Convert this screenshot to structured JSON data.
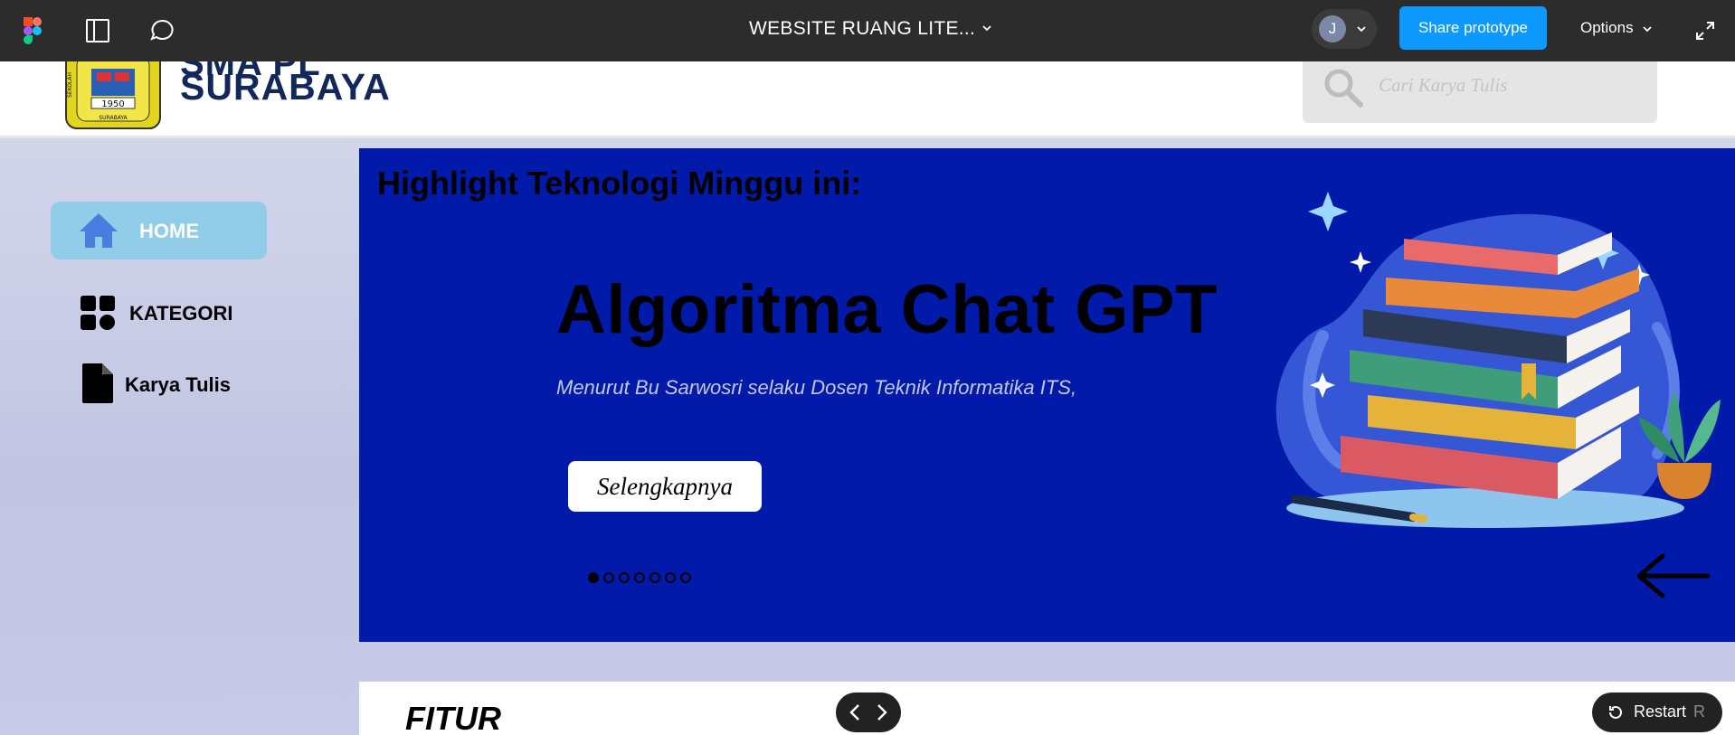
{
  "figma_bar": {
    "file_title": "WEBSITE RUANG LITE...",
    "avatar_initial": "J",
    "share_label": "Share prototype",
    "options_label": "Options"
  },
  "site": {
    "school_name_partial_top": "SMA PL",
    "school_name": "SURABAYA",
    "logo_text_top": "SEKOLAH",
    "logo_year": "1950",
    "logo_city": "SURABAYA",
    "search_placeholder": "Cari Karya Tulis"
  },
  "sidebar": {
    "items": [
      {
        "label": "HOME",
        "icon": "home-icon",
        "active": true
      },
      {
        "label": "KATEGORI",
        "icon": "grid-icon",
        "active": false
      },
      {
        "label": "Karya Tulis",
        "icon": "document-icon",
        "active": false
      }
    ]
  },
  "hero": {
    "heading": "Highlight Teknologi Minggu ini:",
    "title": "Algoritma Chat GPT",
    "subtitle": "Menurut Bu Sarwosri selaku Dosen Teknik Informatika ITS,",
    "button_label": "Selengkapnya",
    "slide_count": 7,
    "active_slide": 1,
    "bg_color": "#011aa9"
  },
  "features": {
    "title": "FITUR"
  },
  "player": {
    "restart_label": "Restart",
    "restart_shortcut": "R"
  },
  "colors": {
    "figma_bar": "#2c2c2c",
    "share_button": "#0d99ff",
    "home_active": "#91cde8",
    "brand_navy": "#12285a"
  }
}
